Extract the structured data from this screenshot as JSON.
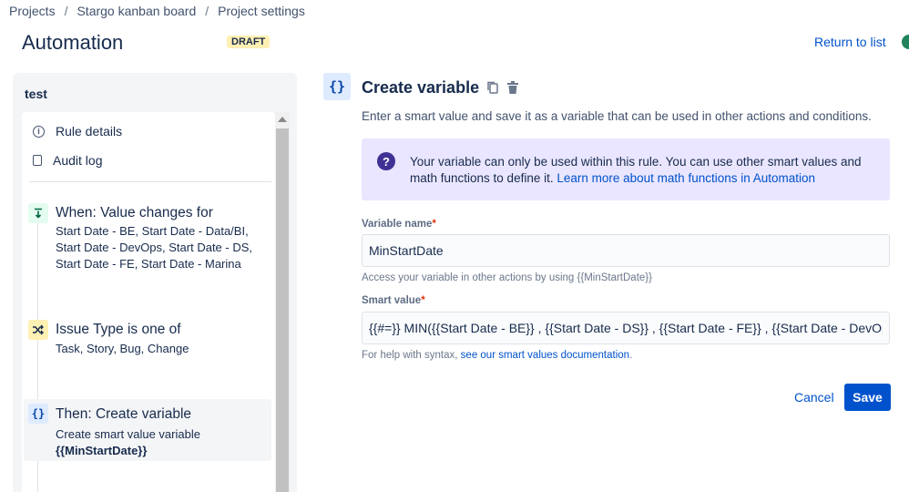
{
  "breadcrumb": {
    "items": [
      "Projects",
      "Stargo kanban board",
      "Project settings"
    ],
    "separator": "/"
  },
  "header": {
    "title": "Automation",
    "badge": "DRAFT",
    "return_link": "Return to list"
  },
  "sidebar": {
    "rule_name": "test",
    "menu": [
      {
        "label": "Rule details",
        "icon": "info-icon"
      },
      {
        "label": "Audit log",
        "icon": "document-icon"
      }
    ],
    "steps": [
      {
        "title": "When: Value changes for",
        "desc": "Start Date - BE, Start Date - Data/BI, Start Date - DevOps, Start Date - DS, Start Date - FE, Start Date - Marina",
        "icon": "trigger-icon",
        "color": "#e3fcef"
      },
      {
        "title": "Issue Type is one of",
        "desc": "Task, Story, Bug, Change",
        "icon": "condition-shuffle-icon",
        "color": "#fff0b3"
      },
      {
        "title": "Then: Create variable",
        "desc": "Create smart value variable",
        "desc_bold": "{{MinStartDate}}",
        "icon": "braces-icon",
        "color": "#deebff"
      }
    ]
  },
  "action": {
    "icon_glyph": "{}",
    "title": "Create variable",
    "description": "Enter a smart value and save it as a variable that can be used in other actions and conditions.",
    "info": {
      "text": "Your variable can only be used within this rule. You can use other smart values and math functions to define it.",
      "link": "Learn more about math functions in Automation"
    },
    "variable_name": {
      "label": "Variable name",
      "required_mark": "*",
      "value": "MinStartDate",
      "help": "Access your variable in other actions by using {{MinStartDate}}"
    },
    "smart_value": {
      "label": "Smart value",
      "required_mark": "*",
      "value": "{{#=}} MIN({{Start Date - BE}} , {{Start Date - DS}} , {{Start Date - FE}} , {{Start Date - DevOps}}) {{/}}",
      "help_prefix": "For help with syntax,",
      "help_link": "see our smart values documentation",
      "help_suffix": "."
    },
    "buttons": {
      "cancel": "Cancel",
      "save": "Save"
    }
  }
}
